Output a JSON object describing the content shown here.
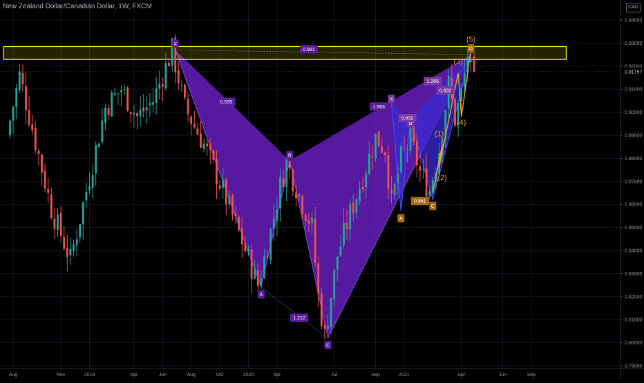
{
  "header": {
    "symbol_title": "New Zealand Dollar/Canadian Dollar, 1W, FXCM",
    "currency": "CAD"
  },
  "colors": {
    "background": "#000000",
    "up": "#26a69a",
    "down": "#ef5350",
    "pattern_fill": "#6a1fc2",
    "pattern_fill_blue": "#3b2bd6",
    "label_purple": "#5b1f9e",
    "label_orange": "#a86a12",
    "wave_orange": "#f0a030",
    "zone_border": "#ffff00",
    "axis_text": "#9598a1"
  },
  "chart_data": {
    "type": "candlestick",
    "title": "New Zealand Dollar/Canadian Dollar, 1W, FXCM",
    "y_axis": {
      "ticks": [
        "0.94000",
        "0.93000",
        "0.92000",
        "0.91000",
        "0.90000",
        "0.89000",
        "0.88000",
        "0.87000",
        "0.86000",
        "0.85000",
        "0.84000",
        "0.83000",
        "0.82000",
        "0.81000",
        "0.80000",
        "0.79000"
      ],
      "range": [
        0.788,
        0.945
      ]
    },
    "x_axis": {
      "ticks": [
        "Aug",
        "Nov",
        "2019",
        "Apr",
        "Jun",
        "Aug",
        "Oct",
        "2020",
        "Apr",
        "Jul",
        "Sep",
        "2021",
        "Apr",
        "Jun",
        "Sep"
      ]
    },
    "last_price": "0.91757",
    "price_path": [
      {
        "week": 0,
        "price": 0.89
      },
      {
        "week": 4,
        "price": 0.916
      },
      {
        "week": 8,
        "price": 0.893
      },
      {
        "week": 14,
        "price": 0.858
      },
      {
        "week": 20,
        "price": 0.836
      },
      {
        "week": 26,
        "price": 0.872
      },
      {
        "week": 31,
        "price": 0.902
      },
      {
        "week": 36,
        "price": 0.91
      },
      {
        "week": 41,
        "price": 0.898
      },
      {
        "week": 46,
        "price": 0.905
      },
      {
        "week": 49,
        "price": 0.916
      },
      {
        "week": 52,
        "price": 0.927
      },
      {
        "week": 56,
        "price": 0.902
      },
      {
        "week": 62,
        "price": 0.886
      },
      {
        "week": 68,
        "price": 0.866
      },
      {
        "week": 74,
        "price": 0.844
      },
      {
        "week": 79,
        "price": 0.825
      },
      {
        "week": 83,
        "price": 0.848
      },
      {
        "week": 86,
        "price": 0.868
      },
      {
        "week": 88,
        "price": 0.878
      },
      {
        "week": 92,
        "price": 0.864
      },
      {
        "week": 96,
        "price": 0.85
      },
      {
        "week": 98,
        "price": 0.82
      },
      {
        "week": 100,
        "price": 0.803
      },
      {
        "week": 104,
        "price": 0.838
      },
      {
        "week": 108,
        "price": 0.856
      },
      {
        "week": 112,
        "price": 0.872
      },
      {
        "week": 116,
        "price": 0.889
      },
      {
        "week": 119,
        "price": 0.884
      },
      {
        "week": 121,
        "price": 0.86
      },
      {
        "week": 124,
        "price": 0.88
      },
      {
        "week": 127,
        "price": 0.888
      },
      {
        "week": 130,
        "price": 0.874
      },
      {
        "week": 133,
        "price": 0.866
      },
      {
        "week": 136,
        "price": 0.884
      },
      {
        "week": 139,
        "price": 0.912
      },
      {
        "week": 141,
        "price": 0.897
      },
      {
        "week": 143,
        "price": 0.908
      },
      {
        "week": 145,
        "price": 0.924
      },
      {
        "week": 146,
        "price": 0.918
      }
    ],
    "zone": {
      "label": "0.981",
      "price_top": 0.9285,
      "price_bottom": 0.9229,
      "week_start": -2,
      "week_end": 175
    },
    "pattern1": {
      "points": [
        {
          "label": "X",
          "week": 52,
          "price": 0.927
        },
        {
          "label": "A",
          "week": 79,
          "price": 0.824
        },
        {
          "label": "B",
          "week": 88,
          "price": 0.879
        },
        {
          "label": "C",
          "week": 100,
          "price": 0.802
        },
        {
          "label": "D",
          "week": 145,
          "price": 0.925
        }
      ],
      "ratios": [
        {
          "text": "0.539",
          "week": 68,
          "price": 0.9045
        },
        {
          "text": "1.212",
          "week": 91,
          "price": 0.8108
        },
        {
          "text": "1.583",
          "week": 116,
          "price": 0.9025
        }
      ]
    },
    "pattern2": {
      "points": [
        {
          "label": "X",
          "week": 120,
          "price": 0.904
        },
        {
          "label": "A",
          "week": 123,
          "price": 0.857
        },
        {
          "label": "B",
          "week": 126,
          "price": 0.897
        },
        {
          "label": "C",
          "week": 133,
          "price": 0.862
        },
        {
          "label": "D",
          "week": 145,
          "price": 0.925
        }
      ],
      "ratios": [
        {
          "text": "1.366",
          "week": 133,
          "price": 0.9135
        },
        {
          "text": "0.832",
          "week": 125,
          "price": 0.8975
        },
        {
          "text": "0.861",
          "week": 129,
          "price": 0.8615
        },
        {
          "text": "0.832",
          "week": 137,
          "price": 0.9095
        }
      ]
    },
    "elliott_waves": [
      {
        "label": "(1)",
        "week": 135,
        "price": 0.8895
      },
      {
        "label": "(2)",
        "week": 136,
        "price": 0.8705
      },
      {
        "label": "(3)",
        "week": 141,
        "price": 0.921
      },
      {
        "label": "(4)",
        "week": 142,
        "price": 0.8945
      },
      {
        "label": "(5)",
        "week": 145,
        "price": 0.9305
      }
    ],
    "wave_path": [
      {
        "week": 133,
        "price": 0.865
      },
      {
        "week": 136,
        "price": 0.886
      },
      {
        "week": 135,
        "price": 0.876
      },
      {
        "week": 141,
        "price": 0.917
      },
      {
        "week": 142,
        "price": 0.898
      },
      {
        "week": 145,
        "price": 0.927
      }
    ]
  }
}
